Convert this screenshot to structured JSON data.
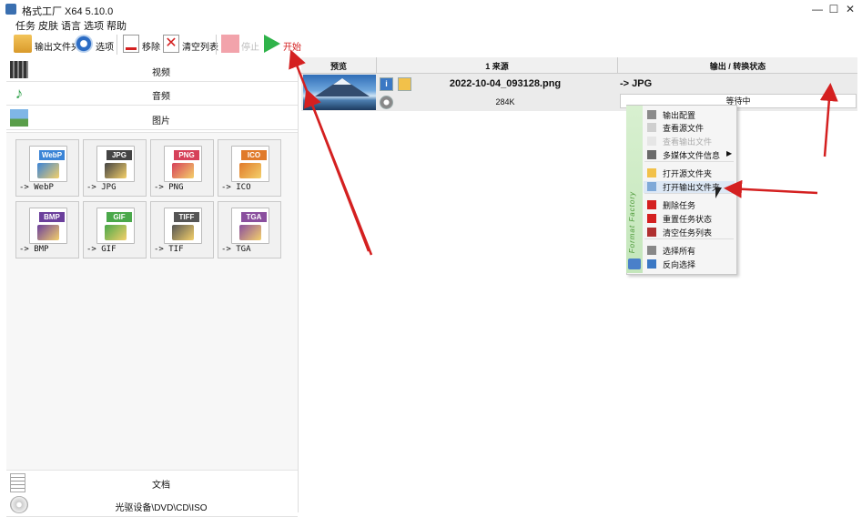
{
  "window": {
    "title": "格式工厂 X64 5.10.0",
    "minimize": "—",
    "maximize": "☐",
    "close": "✕"
  },
  "menu": [
    "任务",
    "皮肤",
    "语言",
    "选项",
    "帮助"
  ],
  "toolbar": {
    "output_folder": "输出文件夹",
    "options": "选项",
    "remove": "移除",
    "clear_list": "清空列表",
    "stop": "停止",
    "start": "开始"
  },
  "categories": {
    "video": "视频",
    "audio": "音频",
    "image": "图片",
    "document": "文档",
    "optical": "光驱设备\\DVD\\CD\\ISO"
  },
  "formats": [
    {
      "tag": "WebP",
      "label": "-> WebP",
      "color": "#3b84d6"
    },
    {
      "tag": "JPG",
      "label": "-> JPG",
      "color": "#444444"
    },
    {
      "tag": "PNG",
      "label": "-> PNG",
      "color": "#d6415a"
    },
    {
      "tag": "ICO",
      "label": "-> ICO",
      "color": "#e07a2a"
    },
    {
      "tag": "BMP",
      "label": "-> BMP",
      "color": "#6b3f9c"
    },
    {
      "tag": "GIF",
      "label": "-> GIF",
      "color": "#4aa84a"
    },
    {
      "tag": "TIFF",
      "label": "-> TIF",
      "color": "#555555"
    },
    {
      "tag": "TGA",
      "label": "-> TGA",
      "color": "#8a4f9e"
    }
  ],
  "table": {
    "col_preview": "预览",
    "col_source": "1 来源",
    "col_output": "输出 / 转换状态"
  },
  "task": {
    "file_name": "2022-10-04_093128.png",
    "file_size": "284K",
    "output_format": "-> JPG",
    "status": "等待中"
  },
  "context_menu": {
    "brand": "Format Factory",
    "items": [
      {
        "label": "输出配置",
        "disabled": false,
        "icon": "gear-icon"
      },
      {
        "label": "查看源文件",
        "disabled": false,
        "icon": "file-icon"
      },
      {
        "label": "查看输出文件",
        "disabled": true,
        "icon": "file-icon"
      },
      {
        "label": "多媒体文件信息",
        "disabled": false,
        "icon": "info-icon",
        "submenu": "▶"
      },
      {
        "label": "打开源文件夹",
        "disabled": false,
        "icon": "folder-icon"
      },
      {
        "label": "打开输出文件夹",
        "disabled": false,
        "icon": "folder-image-icon"
      },
      {
        "label": "删除任务",
        "disabled": false,
        "icon": "delete-icon"
      },
      {
        "label": "重置任务状态",
        "disabled": false,
        "icon": "reset-icon"
      },
      {
        "label": "清空任务列表",
        "disabled": false,
        "icon": "clear-icon"
      },
      {
        "label": "选择所有",
        "disabled": false,
        "icon": "select-all-icon"
      },
      {
        "label": "反向选择",
        "disabled": false,
        "icon": "invert-select-icon"
      }
    ]
  },
  "colors": {
    "arrow": "#d42020",
    "start_green": "#2fb34a",
    "stop_pink": "#f2a3ab"
  }
}
